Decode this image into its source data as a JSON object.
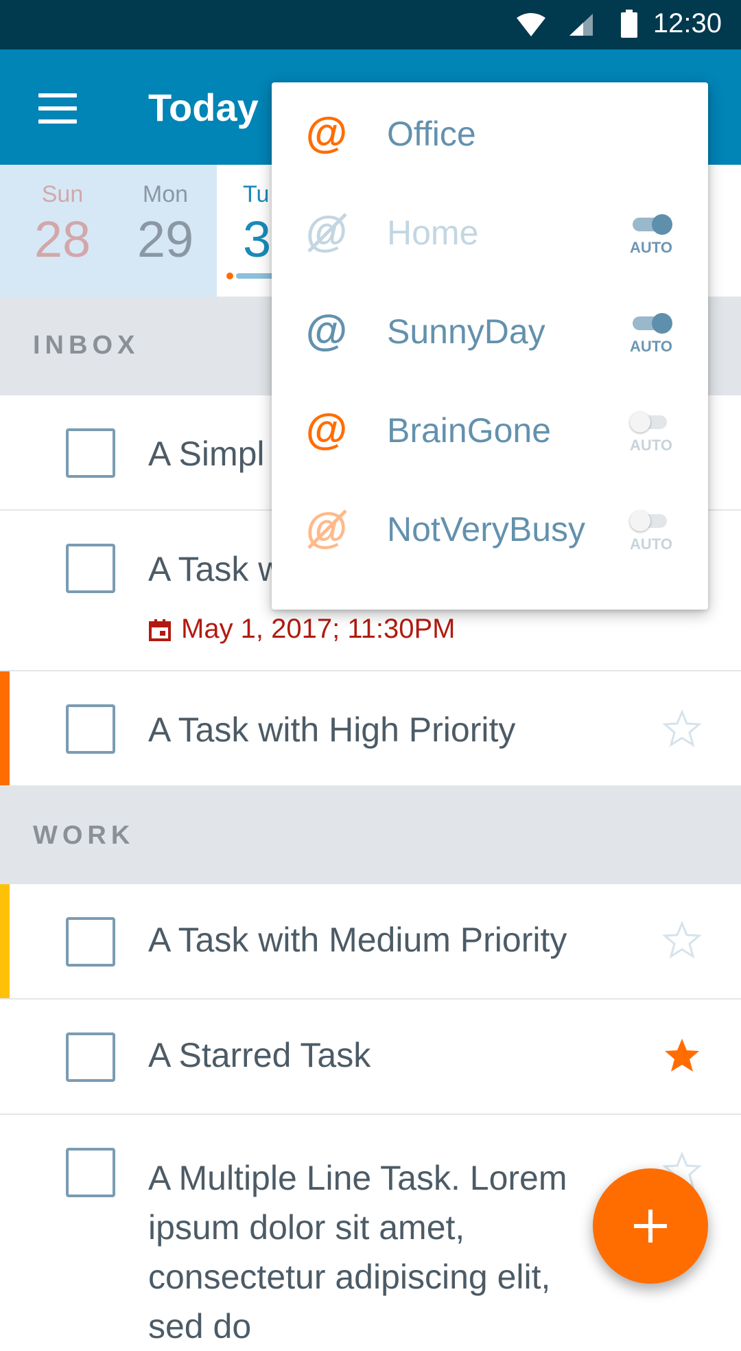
{
  "status_bar": {
    "time": "12:30"
  },
  "app_bar": {
    "title": "Today"
  },
  "date_strip": {
    "days": [
      {
        "name": "Sun",
        "number": "28"
      },
      {
        "name": "Mon",
        "number": "29"
      },
      {
        "name": "Tu",
        "number": "3"
      }
    ]
  },
  "sections": {
    "inbox": {
      "title": "INBOX"
    },
    "work": {
      "title": "WORK"
    }
  },
  "tasks": [
    {
      "title": "A Simpl",
      "starred": false
    },
    {
      "title": "A Task w",
      "due": "May 1, 2017; 11:30PM",
      "due_color": "#b21a10"
    },
    {
      "title": "A Task with High Priority",
      "priority_color": "#ff6d00",
      "starred": false
    },
    {
      "title": "A Task with Medium Priority",
      "priority_color": "#ffc107",
      "starred": false
    },
    {
      "title": "A Starred Task",
      "starred": true,
      "star_color": "#ff6d00"
    },
    {
      "title": "A Multiple Line Task. Lorem ipsum dolor sit amet, consectetur adipiscing elit, sed do",
      "starred": false
    }
  ],
  "context_menu": {
    "items": [
      {
        "label": "Office",
        "icon": "at-icon",
        "icon_color": "#ff6d00",
        "enabled": true
      },
      {
        "label": "Home",
        "icon": "at-crossed-icon",
        "icon_color": "#c3d6e2",
        "enabled": false,
        "auto_label": "AUTO",
        "auto_on": true
      },
      {
        "label": "SunnyDay",
        "icon": "at-icon",
        "icon_color": "#6391ad",
        "enabled": true,
        "auto_label": "AUTO",
        "auto_on": true
      },
      {
        "label": "BrainGone",
        "icon": "at-icon",
        "icon_color": "#ff6d00",
        "enabled": true,
        "auto_label": "AUTO",
        "auto_on": false
      },
      {
        "label": "NotVeryBusy",
        "icon": "at-crossed-icon",
        "icon_color": "#ffb98a",
        "enabled": true,
        "auto_label": "AUTO",
        "auto_on": false
      }
    ]
  },
  "colors": {
    "status_bar": "#01394f",
    "app_bar": "#0184b6",
    "accent": "#ff6d00"
  },
  "fab": {
    "icon": "plus-icon"
  }
}
